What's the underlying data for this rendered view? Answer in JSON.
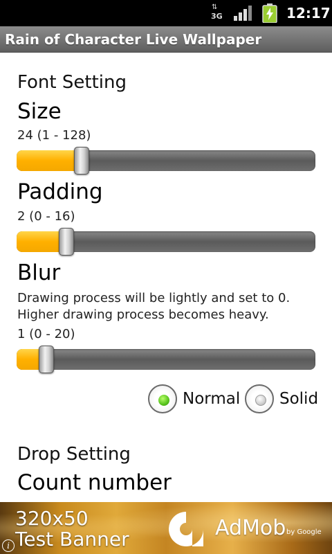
{
  "status_bar": {
    "network_type": "3G",
    "network_arrows": "⇅",
    "time": "12:17",
    "icons": [
      "network-3g-icon",
      "signal-icon",
      "battery-charging-icon"
    ],
    "battery_color": "#9acd32"
  },
  "app_bar": {
    "title": "Rain of Character Live Wallpaper"
  },
  "font_setting": {
    "header": "Font Setting",
    "size": {
      "title": "Size",
      "value_text": "24 (1 - 128)",
      "value": 24,
      "min": 1,
      "max": 128
    },
    "padding": {
      "title": "Padding",
      "value_text": "2 (0 - 16)",
      "value": 2,
      "min": 0,
      "max": 16
    },
    "blur": {
      "title": "Blur",
      "description_line1": "Drawing process will be lightly and set to 0.",
      "description_line2": "Higher drawing process becomes heavy.",
      "value_text": "1 (0 - 20)",
      "value": 1,
      "min": 0,
      "max": 20
    },
    "blur_style": {
      "options": [
        {
          "label": "Normal",
          "selected": true
        },
        {
          "label": "Solid",
          "selected": false
        }
      ]
    }
  },
  "drop_setting": {
    "header": "Drop Setting",
    "count_number": {
      "title": "Count number"
    }
  },
  "ad_banner": {
    "line1": "320x50",
    "line2": "Test Banner",
    "brand": "AdMob",
    "by_google": "by Google",
    "info_icon": "i"
  },
  "colors": {
    "slider_fill": "#ffb000",
    "radio_selected": "#56c21c",
    "title_bar": "#6e6e6e"
  }
}
